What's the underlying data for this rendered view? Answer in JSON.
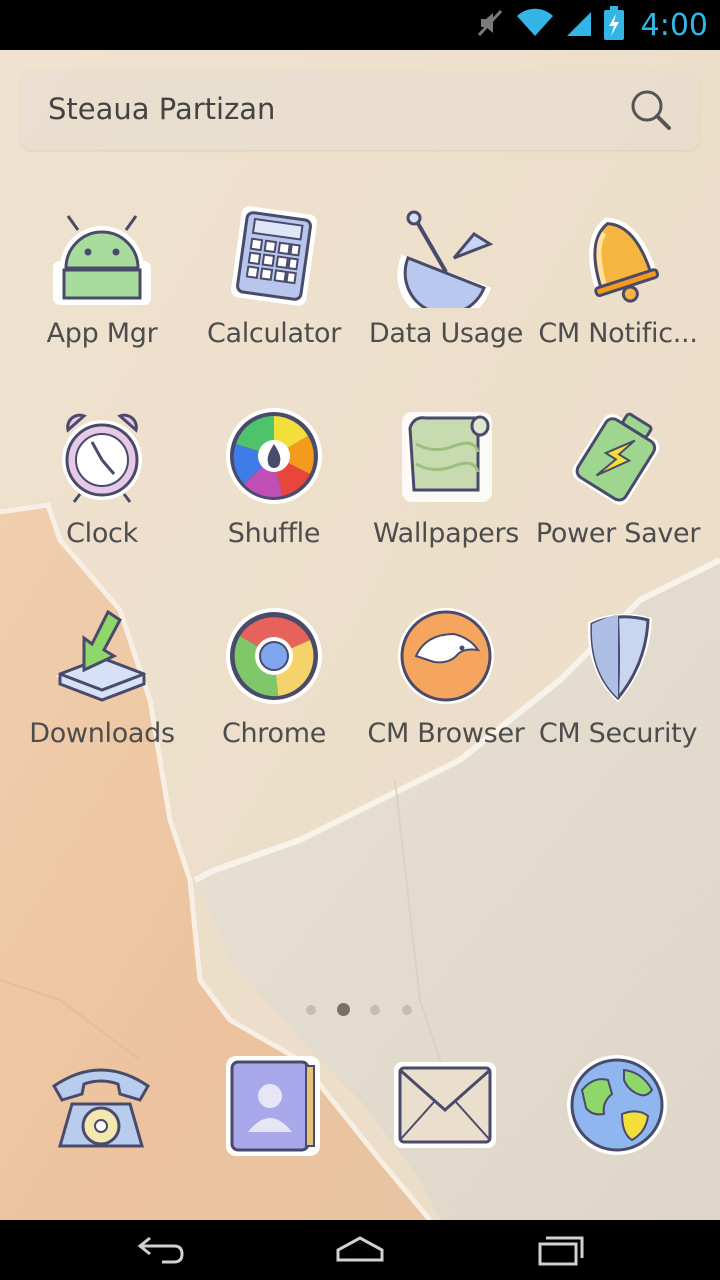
{
  "status_bar": {
    "time": "4:00",
    "icons": [
      "mute-icon",
      "wifi-icon",
      "signal-icon",
      "battery-charging-icon"
    ]
  },
  "search": {
    "text": "Steaua Partizan",
    "icon": "search-icon"
  },
  "apps": [
    {
      "label": "App Mgr",
      "icon": "android-icon"
    },
    {
      "label": "Calculator",
      "icon": "calculator-icon"
    },
    {
      "label": "Data Usage",
      "icon": "satellite-dish-icon"
    },
    {
      "label": "CM Notific...",
      "icon": "bell-icon"
    },
    {
      "label": "Clock",
      "icon": "alarm-clock-icon"
    },
    {
      "label": "Shuffle",
      "icon": "color-wheel-icon"
    },
    {
      "label": "Wallpapers",
      "icon": "scroll-icon"
    },
    {
      "label": "Power Saver",
      "icon": "battery-icon"
    },
    {
      "label": "Downloads",
      "icon": "download-tray-icon"
    },
    {
      "label": "Chrome",
      "icon": "chrome-icon"
    },
    {
      "label": "CM Browser",
      "icon": "cheetah-icon"
    },
    {
      "label": "CM Security",
      "icon": "shield-icon"
    }
  ],
  "page_indicator": {
    "count": 4,
    "active": 1
  },
  "dock": [
    {
      "icon": "telephone-icon"
    },
    {
      "icon": "contacts-book-icon"
    },
    {
      "icon": "envelope-icon"
    },
    {
      "icon": "globe-icon"
    }
  ],
  "navigation": [
    "back-icon",
    "home-icon",
    "recents-icon"
  ],
  "colors": {
    "status_bar_bg": "#000000",
    "time_color": "#33b5e5",
    "paper_light": "#efe3d2",
    "paper_peach": "#ecc8a6",
    "paper_grey": "#e4ddd0",
    "label_color": "#4d4d4d"
  }
}
